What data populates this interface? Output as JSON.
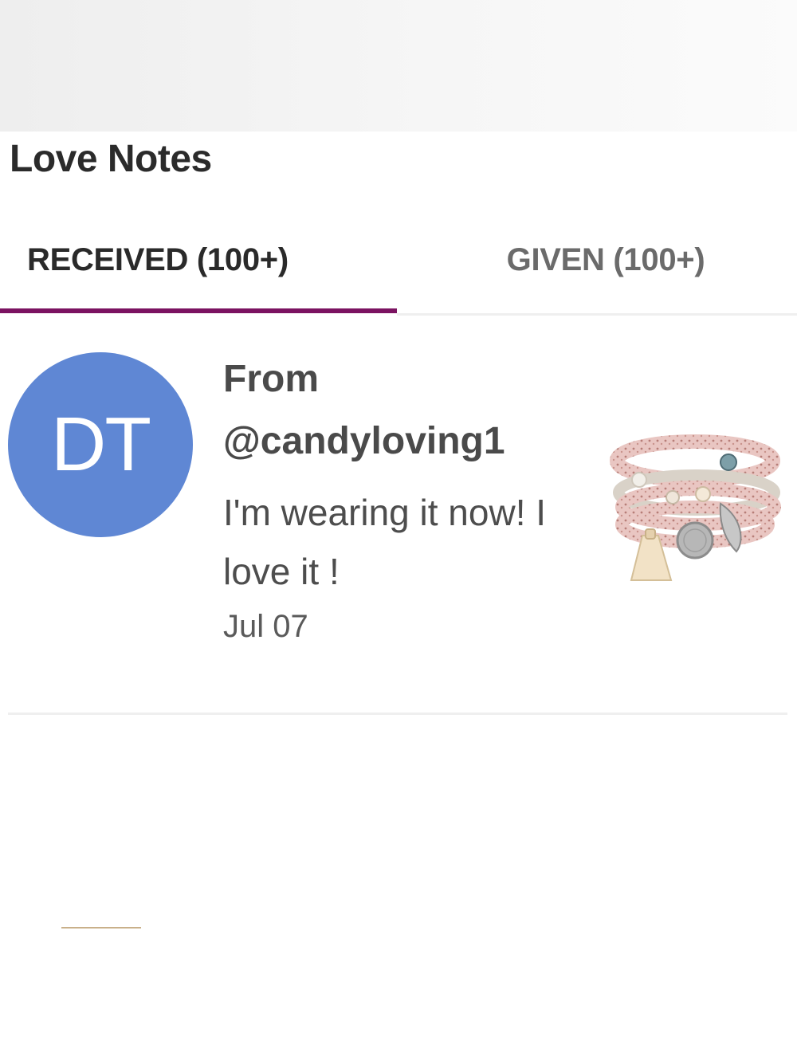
{
  "page": {
    "title": "Love Notes"
  },
  "tabs": {
    "received_label": "RECEIVED (100+)",
    "given_label": "GIVEN (100+)",
    "active": "received",
    "accent_color": "#7b1361"
  },
  "notes": [
    {
      "avatar_initials": "DT",
      "avatar_color": "#5f87d4",
      "from_label": "From",
      "sender": "@candyloving1",
      "message": "I'm wearing it now! I love it !",
      "date": "Jul 07",
      "product_image": "beaded-bracelet-stack-with-tassel"
    }
  ]
}
